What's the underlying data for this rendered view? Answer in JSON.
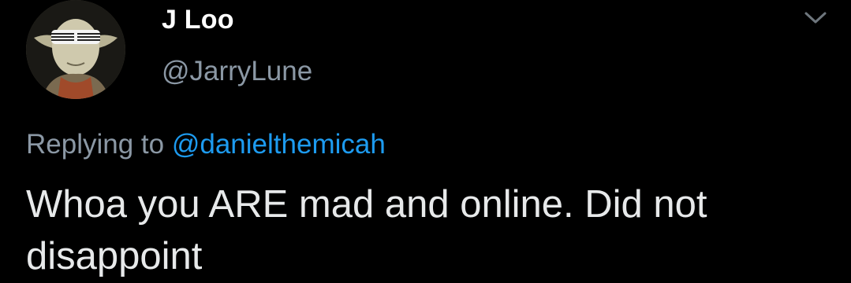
{
  "tweet": {
    "author": {
      "display_name": "J Loo",
      "handle": "@JarryLune",
      "avatar_icon": "yoda-shutter-shades-avatar"
    },
    "menu_icon": "chevron-down-icon",
    "reply": {
      "prefix": "Replying to",
      "mention": "@danielthemicah"
    },
    "text": "Whoa you ARE mad and online. Did not disappoint"
  },
  "colors": {
    "background": "#000000",
    "primary_text": "#e7e9ea",
    "secondary_text": "#8b98a5",
    "accent": "#1d9bf0"
  }
}
